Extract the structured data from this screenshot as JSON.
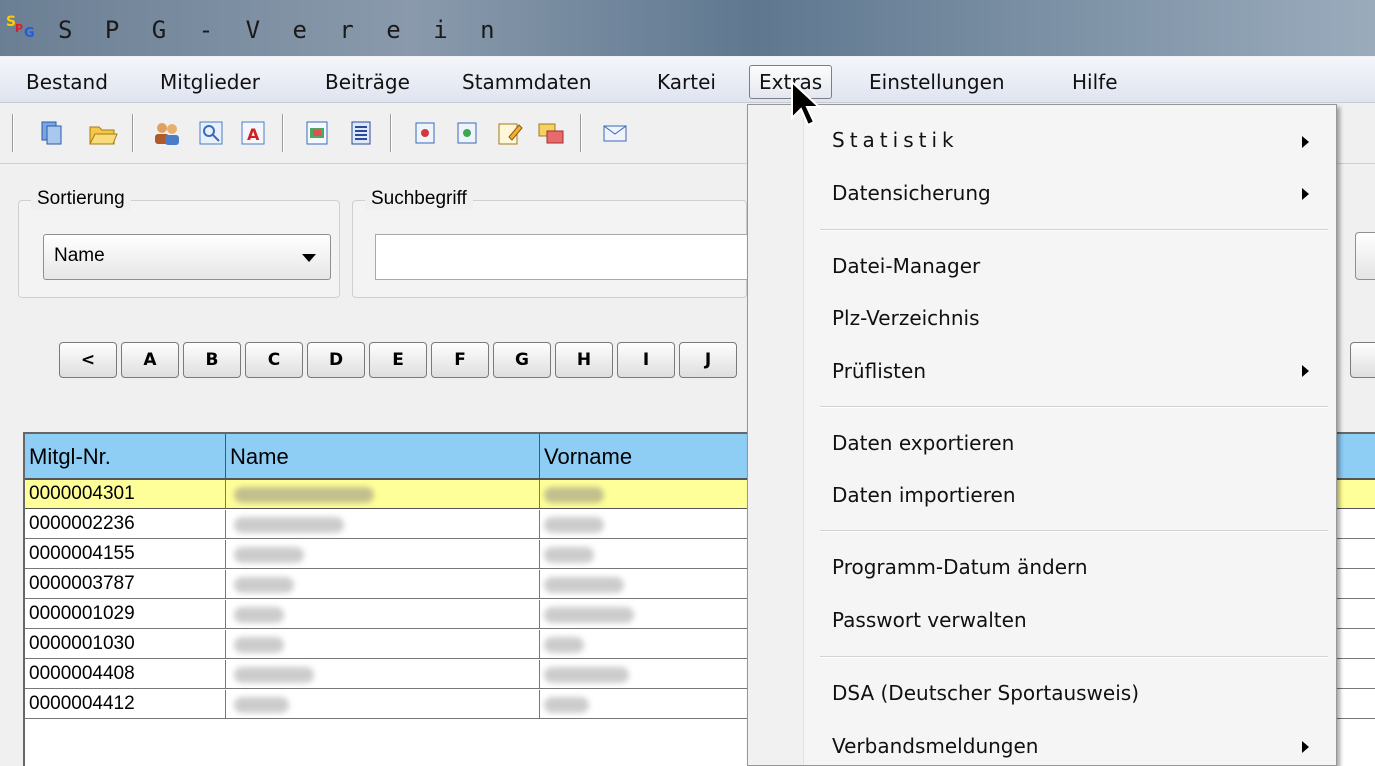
{
  "window": {
    "title": "S P G - V e r e i n",
    "logo": [
      "S",
      "P",
      "G"
    ]
  },
  "menubar": [
    {
      "label": "Bestand"
    },
    {
      "label": "Mitglieder"
    },
    {
      "label": "Beiträge"
    },
    {
      "label": "Stammdaten"
    },
    {
      "label": "Kartei"
    },
    {
      "label": "Extras"
    },
    {
      "label": "Einstellungen"
    },
    {
      "label": "Hilfe"
    }
  ],
  "filters": {
    "sort_label": "Sortierung",
    "sort_value": "Name",
    "search_label": "Suchbegriff",
    "search_value": ""
  },
  "letters": [
    "<",
    "A",
    "B",
    "C",
    "D",
    "E",
    "F",
    "G",
    "H",
    "I",
    "J"
  ],
  "table": {
    "columns": [
      "Mitgl-Nr.",
      "Name",
      "Vorname"
    ],
    "rows": [
      {
        "nr": "0000004301"
      },
      {
        "nr": "0000002236"
      },
      {
        "nr": "0000004155"
      },
      {
        "nr": "0000003787"
      },
      {
        "nr": "0000001029"
      },
      {
        "nr": "0000001030"
      },
      {
        "nr": "0000004408"
      },
      {
        "nr": "0000004412"
      }
    ]
  },
  "extras_menu": [
    {
      "label": "Statistik"
    },
    {
      "label": "Datensicherung"
    },
    {
      "label": "Datei-Manager"
    },
    {
      "label": "Plz-Verzeichnis"
    },
    {
      "label": "Prüflisten"
    },
    {
      "label": "Daten exportieren"
    },
    {
      "label": "Daten importieren"
    },
    {
      "label": "Programm-Datum ändern"
    },
    {
      "label": "Passwort verwalten"
    },
    {
      "label": "DSA (Deutscher Sportausweis)"
    },
    {
      "label": "Verbandsmeldungen"
    }
  ]
}
